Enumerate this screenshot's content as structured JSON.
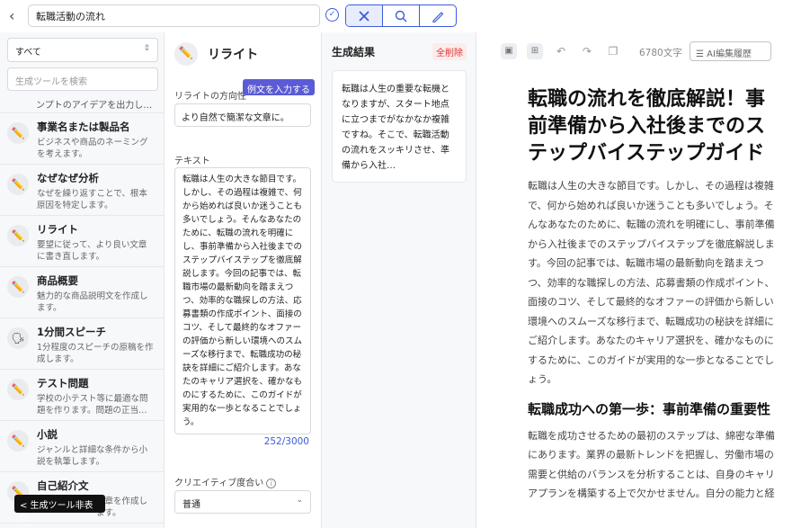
{
  "header": {
    "back_icon": "chevron-left-icon",
    "doc_title": "転職活動の流れ",
    "tool_icons": [
      "tools-icon",
      "search-icon",
      "pen-icon"
    ]
  },
  "sidebar": {
    "category_select": "すべて",
    "search_placeholder": "生成ツールを検索",
    "cut_text": "ンプトのアイデアを出力し…",
    "items": [
      {
        "name": "事業名または製品名",
        "desc": "ビジネスや商品のネーミングを考えます。"
      },
      {
        "name": "なぜなぜ分析",
        "desc": "なぜを繰り返すことで、根本原因を特定します。"
      },
      {
        "name": "リライト",
        "desc": "要望に従って、より良い文章に書き直します。"
      },
      {
        "name": "商品概要",
        "desc": "魅力的な商品説明文を作成します。"
      },
      {
        "name": "1分間スピーチ",
        "desc": "1分程度のスピーチの原稿を作成します。"
      },
      {
        "name": "テスト問題",
        "desc": "学校の小テスト等に最適な問題を作ります。問題の正当…"
      },
      {
        "name": "小説",
        "desc": "ジャンルと詳細な条件から小説を執筆します。"
      },
      {
        "name": "自己紹介文",
        "desc": "文章を作成します。"
      }
    ],
    "hide_button": "< 生成ツール非表示"
  },
  "tool": {
    "title": "リライト",
    "example_button": "例文を入力する",
    "direction_label": "リライトの方向性",
    "direction_value": "より自然で簡潔な文章に。",
    "text_label": "テキスト",
    "text_value": "転職は人生の大きな節目です。しかし、その過程は複雑で、何から始めれば良いか迷うことも多いでしょう。そんなあなたのために、転職の流れを明確にし、事前準備から入社後までのステップバイステップを徹底解説します。今回の記事では、転職市場の最新動向を踏まえつつ、効率的な職探しの方法、応募書類の作成ポイント、面接のコツ、そして最終的なオファーの評価から新しい環境へのスムーズな移行まで、転職成功の秘訣を詳細にご紹介します。あなたのキャリア選択を、確かなものにするために、このガイドが実用的な一歩となることでしょう。",
    "char_count": "252/3000",
    "creativity_label": "クリエイティブ度合い",
    "creativity_value": "普通"
  },
  "results": {
    "title": "生成結果",
    "delete_all": "全削除",
    "card_text": "転職は人生の重要な転機となりますが、スタート地点に立つまでがなかなか複雑ですね。そこで、転職活動の流れをスッキリさせ、準備から入社…"
  },
  "editor": {
    "word_count": "6780文字",
    "history_button": "AI編集履歴",
    "heading1": "転職の流れを徹底解説！事前準備から入社後までのステップバイステップガイド",
    "paragraph1": "転職は人生の大きな節目です。しかし、その過程は複雑で、何から始めれば良いか迷うことも多いでしょう。そんなあなたのために、転職の流れを明確にし、事前準備から入社後までのステップバイステップを徹底解説します。今回の記事では、転職市場の最新動向を踏まえつつ、効率的な職探しの方法、応募書類の作成ポイント、面接のコツ、そして最終的なオファーの評価から新しい環境へのスムーズな移行まで、転職成功の秘訣を詳細にご紹介します。あなたのキャリア選択を、確かなものにするために、このガイドが実用的な一歩となることでしょう。",
    "heading2": "転職成功への第一歩：事前準備の重要性",
    "paragraph2": "転職を成功させるための最初のステップは、綿密な準備にあります。業界の最新トレンドを把握し、労働市場の需要と供給のバランスを分析することは、自身のキャリアプランを構築する上で欠かせません。自分の能力と経"
  }
}
